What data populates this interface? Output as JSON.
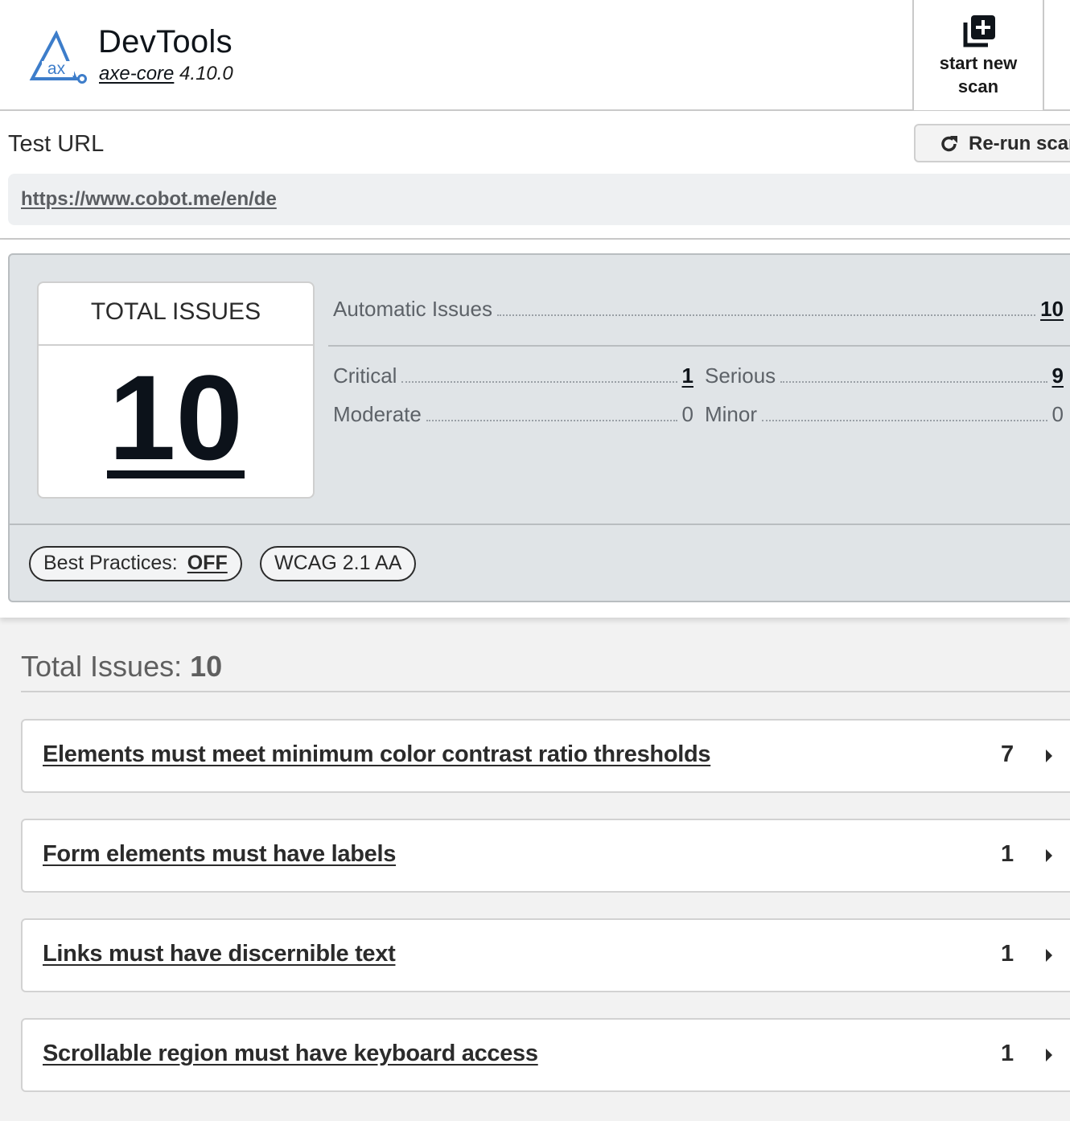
{
  "header": {
    "title": "DevTools",
    "engine_name": "axe-core",
    "engine_version": "4.10.0",
    "logo_text": "ax",
    "new_scan_line1": "start new",
    "new_scan_line2": "scan",
    "brand_color": "#3d7dca"
  },
  "test_url": {
    "label": "Test URL",
    "url": "https://www.cobot.me/en/de",
    "rerun_label": "Re-run scan"
  },
  "summary": {
    "total_label": "TOTAL ISSUES",
    "total_value": "10",
    "automatic_label": "Automatic Issues",
    "automatic_value": "10",
    "severities": [
      {
        "label": "Critical",
        "value": "1",
        "link": true
      },
      {
        "label": "Serious",
        "value": "9",
        "link": true
      },
      {
        "label": "Moderate",
        "value": "0",
        "link": false
      },
      {
        "label": "Minor",
        "value": "0",
        "link": false
      }
    ],
    "best_practices_label": "Best Practices:",
    "best_practices_value": "OFF",
    "standard": "WCAG 2.1 AA"
  },
  "issues": {
    "heading_label": "Total Issues:",
    "heading_value": "10",
    "items": [
      {
        "title": "Elements must meet minimum color contrast ratio thresholds",
        "count": "7"
      },
      {
        "title": "Form elements must have labels",
        "count": "1"
      },
      {
        "title": "Links must have discernible text",
        "count": "1"
      },
      {
        "title": "Scrollable region must have keyboard access",
        "count": "1"
      }
    ]
  }
}
